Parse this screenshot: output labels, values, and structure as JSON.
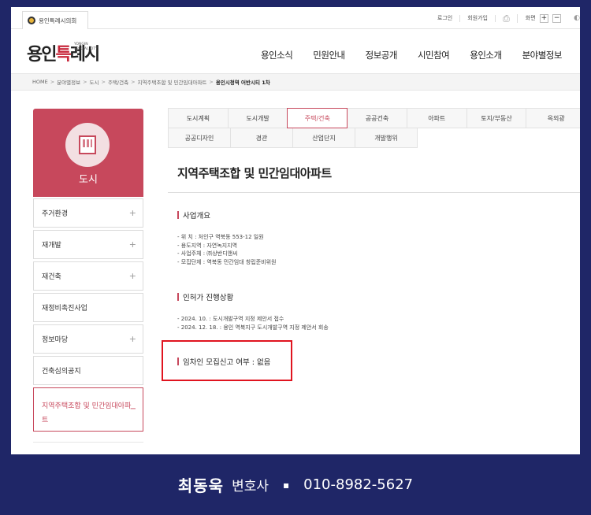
{
  "util": {
    "site_name": "용인특례시의회",
    "login": "로그인",
    "join": "회원가입",
    "print_icon": "printer-icon",
    "zoom_label": "화면",
    "zoom_plus": "+",
    "zoom_minus": "−"
  },
  "header": {
    "logo_main_a": "용인",
    "logo_main_b": "특",
    "logo_main_c": "례시",
    "logo_small": "YONGIN SPECIAL CITY",
    "gnb": [
      "용인소식",
      "민원안내",
      "정보공개",
      "시민참여",
      "용인소개",
      "분야별정보"
    ]
  },
  "breadcrumb": [
    "HOME",
    "분야별정보",
    "도시",
    "주택/건축",
    "지역주택조합 및 민간임대아파트",
    "용인시청역 어반시티 1차"
  ],
  "lnb": {
    "title": "도시",
    "icon": "building-icon",
    "items": [
      {
        "label": "주거환경",
        "plus": "+"
      },
      {
        "label": "재개발",
        "plus": "+"
      },
      {
        "label": "재건축",
        "plus": "+"
      },
      {
        "label": "재정비촉진사업",
        "plus": ""
      },
      {
        "label": "정보마당",
        "plus": "+"
      },
      {
        "label": "건축심의공지",
        "plus": ""
      }
    ],
    "active_line1": "지역주택조합 및 민간임대아파",
    "active_line2": "트",
    "active_mark": "−"
  },
  "tabs": {
    "row1": [
      "도시계획",
      "도시개발",
      "주택/건축",
      "공공건축",
      "아파트",
      "토지/부동산",
      "옥외광"
    ],
    "row2": [
      "공공디자인",
      "경관",
      "산업단지",
      "개발행위"
    ],
    "active": "주택/건축"
  },
  "content": {
    "title": "지역주택조합 및 민간임대아파트",
    "section1": "사업개요",
    "info1": [
      "- 위 치 : 처인구 역북동 553-12 일원",
      "- 용도지역 : 자연녹지지역",
      "- 사업주체 : ㈜상반디앤씨",
      "- 모집단체 : 역북동 민간임대 창립준비위원"
    ],
    "section2": "인허가 진행상황",
    "info2": [
      "- 2024. 10. : 도시개발구역 지정 제안서 접수",
      "- 2024. 12. 18. : 용인 역북지구 도시개발구역 지정 제안서 회송"
    ],
    "section3": "임차인 모집신고 여부 : 없음"
  },
  "footer": {
    "name": "최동욱",
    "role": "변호사",
    "bullet": "▪",
    "phone": "010-8982-5627"
  },
  "colors": {
    "accent": "#c7485c",
    "footer_bg": "#1f2667",
    "highlight_box": "#e0141f"
  }
}
